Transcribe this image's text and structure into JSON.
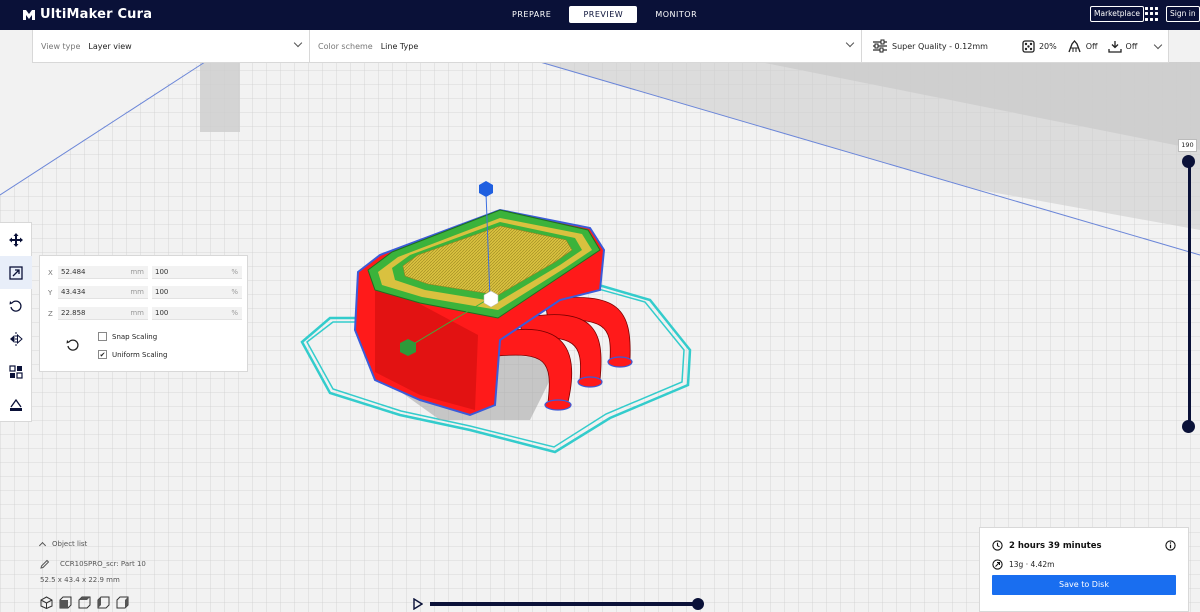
{
  "app": {
    "title": "UltiMaker Cura"
  },
  "stages": [
    {
      "label": "PREPARE",
      "active": false
    },
    {
      "label": "PREVIEW",
      "active": true
    },
    {
      "label": "MONITOR",
      "active": false
    }
  ],
  "topbar": {
    "marketplace_label": "Marketplace",
    "signin_label": "Sign in",
    "apps_icon": "apps-grid-icon"
  },
  "view_settings": {
    "view_type_label": "View type",
    "view_type_value": "Layer view",
    "color_scheme_label": "Color scheme",
    "color_scheme_value": "Line Type"
  },
  "print_setup": {
    "profile": "Super Quality - 0.12mm",
    "infill": "20%",
    "support": "Off",
    "adhesion": "Off"
  },
  "scale_tool": {
    "x_label": "X",
    "x_mm": "52.484",
    "x_pct": "100",
    "y_label": "Y",
    "y_mm": "43.434",
    "y_pct": "100",
    "z_label": "Z",
    "z_mm": "22.858",
    "z_pct": "100",
    "unit_mm": "mm",
    "unit_pct": "%",
    "snap_scaling_label": "Snap Scaling",
    "snap_scaling_checked": false,
    "uniform_scaling_label": "Uniform Scaling",
    "uniform_scaling_checked": true
  },
  "layer_slider": {
    "current_layer": "190"
  },
  "object_list": {
    "header": "Object list",
    "object_name": "CCR10SPRO_scr: Part 10",
    "dimensions": "52.5 x 43.4 x 22.9 mm"
  },
  "print_info": {
    "time": "2 hours 39 minutes",
    "material": "13g · 4.42m",
    "save_label": "Save to Disk"
  },
  "colors": {
    "topbar": "#0a1138",
    "accent_blue": "#196ef0",
    "wall_red": "#ff1a1a",
    "infill_yellow": "#d9c13f",
    "skin_green": "#3bb33b",
    "skirt_cyan": "#33cccc"
  }
}
